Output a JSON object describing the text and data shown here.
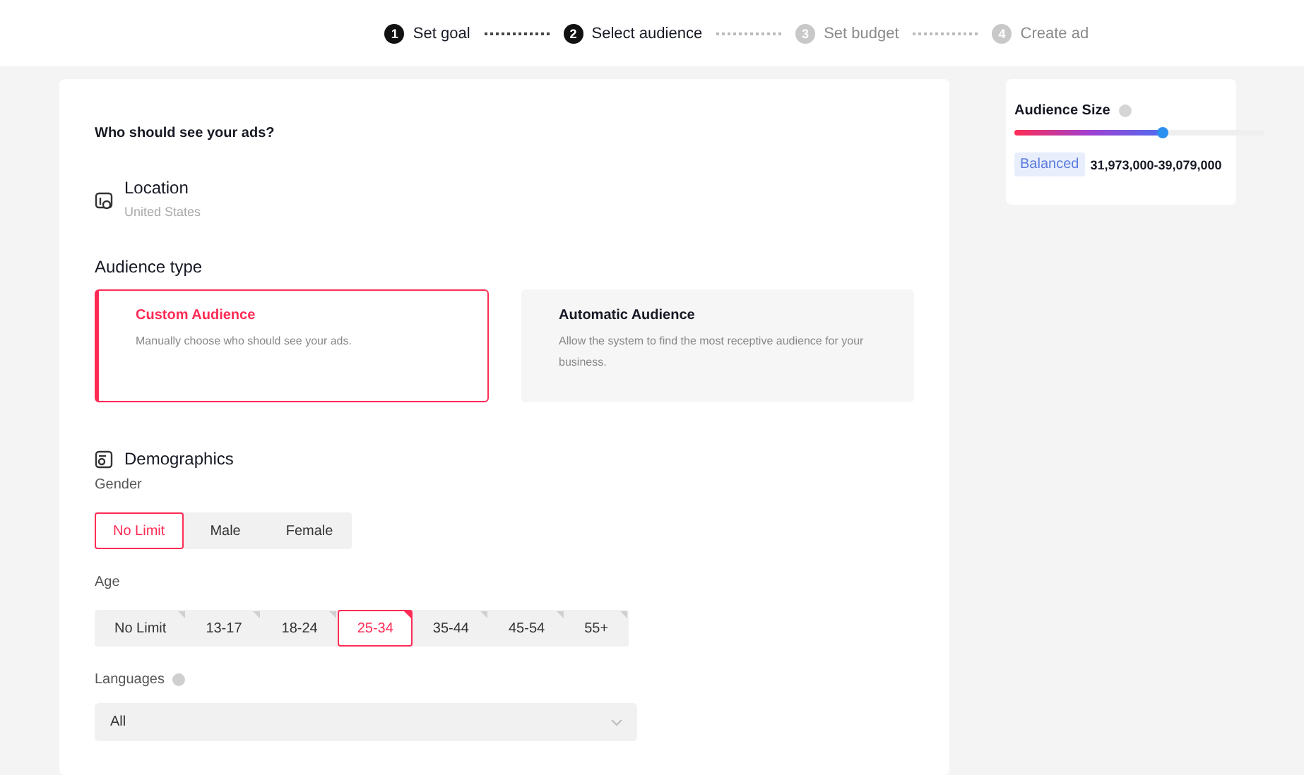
{
  "steps": [
    {
      "number": "1",
      "label": "Set goal",
      "active": true
    },
    {
      "number": "2",
      "label": "Select audience",
      "active": true
    },
    {
      "number": "3",
      "label": "Set budget",
      "active": false
    },
    {
      "number": "4",
      "label": "Create ad",
      "active": false
    }
  ],
  "form": {
    "heading": "Who should see your ads?",
    "location": {
      "label": "Location",
      "value": "United States"
    },
    "audience_type": {
      "label": "Audience type",
      "options": [
        {
          "title": "Custom Audience",
          "description": "Manually choose who should see your ads.",
          "selected": true
        },
        {
          "title": "Automatic Audience",
          "description": "Allow the system to find the most receptive audience for your business.",
          "selected": false
        }
      ]
    },
    "demographics": {
      "label": "Demographics",
      "gender": {
        "label": "Gender",
        "options": [
          {
            "label": "No Limit",
            "selected": true
          },
          {
            "label": "Male",
            "selected": false
          },
          {
            "label": "Female",
            "selected": false
          }
        ]
      },
      "age": {
        "label": "Age",
        "options": [
          {
            "label": "No Limit",
            "selected": false
          },
          {
            "label": "13-17",
            "selected": false
          },
          {
            "label": "18-24",
            "selected": false
          },
          {
            "label": "25-34",
            "selected": true
          },
          {
            "label": "35-44",
            "selected": false
          },
          {
            "label": "45-54",
            "selected": false
          },
          {
            "label": "55+",
            "selected": false
          }
        ]
      },
      "languages": {
        "label": "Languages",
        "value": "All"
      }
    }
  },
  "audience_size": {
    "title": "Audience Size",
    "level": 0.6,
    "tag": "Balanced",
    "range": "31,973,000-39,079,000"
  }
}
